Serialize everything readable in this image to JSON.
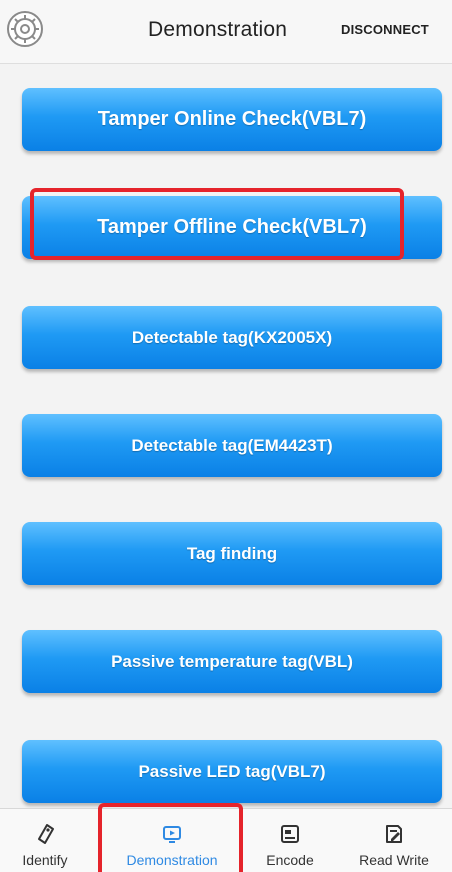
{
  "header": {
    "title": "Demonstration",
    "disconnect_label": "DISCONNECT",
    "settings_icon": "gear-icon"
  },
  "buttons": [
    {
      "label": "Tamper Online Check(VBL7)"
    },
    {
      "label": "Tamper Offline Check(VBL7)"
    },
    {
      "label": "Detectable tag(KX2005X)"
    },
    {
      "label": "Detectable tag(EM4423T)"
    },
    {
      "label": "Tag finding"
    },
    {
      "label": "Passive temperature tag(VBL)"
    },
    {
      "label": "Passive LED tag(VBL7)"
    }
  ],
  "bottom_nav": {
    "items": [
      {
        "label": "Identify",
        "icon": "tag-icon"
      },
      {
        "label": "Demonstration",
        "icon": "play-screen-icon",
        "active": true
      },
      {
        "label": "Encode",
        "icon": "card-icon"
      },
      {
        "label": "Read Write",
        "icon": "edit-icon"
      }
    ]
  },
  "colors": {
    "accent": "#2f8ae3",
    "button_top": "#5fc0ff",
    "button_bottom": "#0a80e6",
    "highlight": "#e5242b"
  }
}
